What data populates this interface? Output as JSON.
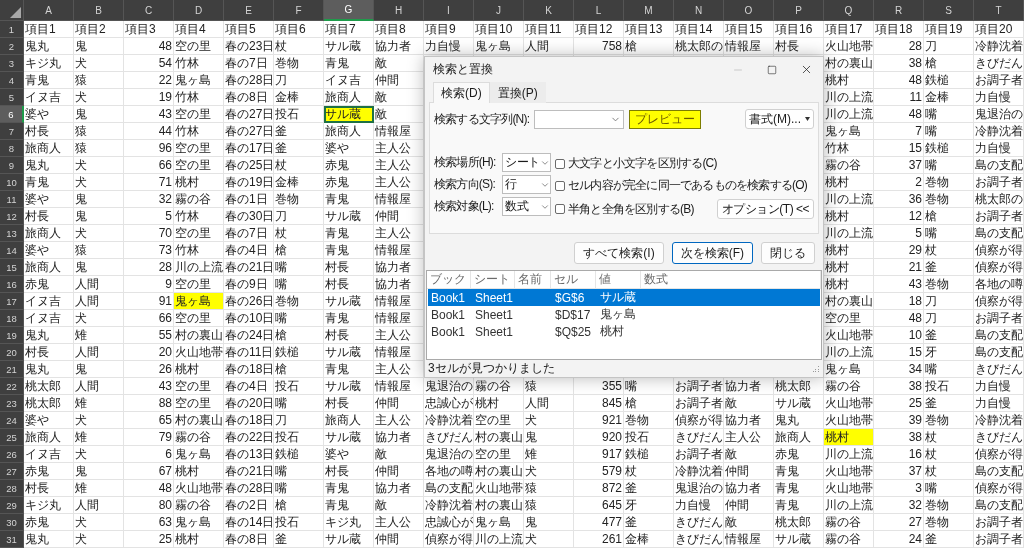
{
  "sheet": {
    "columns": [
      {
        "label": "A",
        "kind": "text",
        "selected": false
      },
      {
        "label": "B",
        "kind": "text",
        "selected": false
      },
      {
        "label": "C",
        "kind": "number",
        "selected": false
      },
      {
        "label": "D",
        "kind": "text",
        "selected": false
      },
      {
        "label": "E",
        "kind": "text",
        "selected": false
      },
      {
        "label": "F",
        "kind": "text",
        "selected": false
      },
      {
        "label": "G",
        "kind": "text",
        "selected": true
      },
      {
        "label": "H",
        "kind": "text",
        "selected": false
      },
      {
        "label": "I",
        "kind": "text",
        "selected": false
      },
      {
        "label": "J",
        "kind": "text",
        "selected": false
      },
      {
        "label": "K",
        "kind": "text",
        "selected": false
      },
      {
        "label": "L",
        "kind": "number",
        "selected": false
      },
      {
        "label": "M",
        "kind": "text",
        "selected": false
      },
      {
        "label": "N",
        "kind": "text",
        "selected": false
      },
      {
        "label": "O",
        "kind": "text",
        "selected": false
      },
      {
        "label": "P",
        "kind": "text",
        "selected": false
      },
      {
        "label": "Q",
        "kind": "text",
        "selected": false
      },
      {
        "label": "R",
        "kind": "number",
        "selected": false
      },
      {
        "label": "S",
        "kind": "text",
        "selected": false
      },
      {
        "label": "T",
        "kind": "text",
        "selected": false
      }
    ],
    "rows": [
      {
        "number": "1",
        "kind": "header",
        "selected": false,
        "cells": [
          "項目1",
          "項目2",
          "項目3",
          "項目4",
          "項目5",
          "項目6",
          "項目7",
          "項目8",
          "項目9",
          "項目10",
          "項目11",
          "項目12",
          "項目13",
          "項目14",
          "項目15",
          "項目16",
          "項目17",
          "項目18",
          "項目19",
          "項目20"
        ]
      },
      {
        "number": "2",
        "kind": "data",
        "selected": false,
        "cells": [
          "鬼丸",
          "鬼",
          "48",
          "空の里",
          "春の23日",
          "杖",
          "サル蔵",
          "協力者",
          "力自慢",
          "鬼ヶ島",
          "人間",
          "758",
          "槍",
          "桃太郎の",
          "情報屋",
          "村長",
          "火山地帯",
          "28",
          "刀",
          "冷静沈着"
        ]
      },
      {
        "number": "3",
        "kind": "data",
        "selected": false,
        "cells": [
          "キジ丸",
          "犬",
          "54",
          "竹林",
          "春の7日",
          "巻物",
          "青鬼",
          "敵",
          null,
          null,
          null,
          null,
          null,
          null,
          null,
          null,
          "村の裏山",
          "38",
          "槍",
          "きびだん"
        ]
      },
      {
        "number": "4",
        "kind": "data",
        "selected": false,
        "cells": [
          "青鬼",
          "猿",
          "22",
          "鬼ヶ島",
          "春の28日",
          "刀",
          "イヌ吉",
          "仲間",
          null,
          null,
          null,
          null,
          null,
          null,
          null,
          null,
          "桃村",
          "48",
          "鉄槌",
          "お調子者"
        ]
      },
      {
        "number": "5",
        "kind": "data",
        "selected": false,
        "cells": [
          "イヌ吉",
          "犬",
          "19",
          "竹林",
          "春の8日",
          "金棒",
          "旅商人",
          "敵",
          null,
          null,
          null,
          null,
          null,
          null,
          null,
          null,
          "川の上流",
          "11",
          "金棒",
          "力自慢"
        ]
      },
      {
        "number": "6",
        "kind": "data",
        "selected": true,
        "cells": [
          "婆や",
          "鬼",
          "43",
          "空の里",
          "春の27日",
          "投石",
          {
            "text": "サル蔵",
            "highlighted": true,
            "active": true
          },
          "敵",
          null,
          null,
          null,
          null,
          null,
          null,
          null,
          null,
          "川の上流",
          "48",
          "嘴",
          "鬼退治の"
        ]
      },
      {
        "number": "7",
        "kind": "data",
        "selected": false,
        "cells": [
          "村長",
          "猿",
          "44",
          "竹林",
          "春の27日",
          "釜",
          "旅商人",
          "情報屋",
          null,
          null,
          null,
          null,
          null,
          null,
          null,
          null,
          "鬼ヶ島",
          "7",
          "嘴",
          "冷静沈着"
        ]
      },
      {
        "number": "8",
        "kind": "data",
        "selected": false,
        "cells": [
          "旅商人",
          "猿",
          "96",
          "空の里",
          "春の17日",
          "釜",
          "婆や",
          "主人公",
          null,
          null,
          null,
          null,
          null,
          null,
          null,
          null,
          "竹林",
          "15",
          "鉄槌",
          "力自慢"
        ]
      },
      {
        "number": "9",
        "kind": "data",
        "selected": false,
        "cells": [
          "鬼丸",
          "犬",
          "66",
          "空の里",
          "春の25日",
          "杖",
          "赤鬼",
          "主人公",
          null,
          null,
          null,
          null,
          null,
          null,
          null,
          null,
          "霧の谷",
          "37",
          "嘴",
          "島の支配"
        ]
      },
      {
        "number": "10",
        "kind": "data",
        "selected": false,
        "cells": [
          "青鬼",
          "犬",
          "71",
          "桃村",
          "春の19日",
          "金棒",
          "赤鬼",
          "主人公",
          null,
          null,
          null,
          null,
          null,
          null,
          null,
          null,
          "桃村",
          "2",
          "巻物",
          "お調子者"
        ]
      },
      {
        "number": "11",
        "kind": "data",
        "selected": false,
        "cells": [
          "婆や",
          "鬼",
          "32",
          "霧の谷",
          "春の1日",
          "巻物",
          "青鬼",
          "情報屋",
          null,
          null,
          null,
          null,
          null,
          null,
          null,
          null,
          "川の上流",
          "36",
          "巻物",
          "桃太郎の"
        ]
      },
      {
        "number": "12",
        "kind": "data",
        "selected": false,
        "cells": [
          "村長",
          "鬼",
          "5",
          "竹林",
          "春の30日",
          "刀",
          "サル蔵",
          "仲間",
          null,
          null,
          null,
          null,
          null,
          null,
          null,
          null,
          "桃村",
          "12",
          "槍",
          "お調子者"
        ]
      },
      {
        "number": "13",
        "kind": "data",
        "selected": false,
        "cells": [
          "旅商人",
          "犬",
          "70",
          "空の里",
          "春の7日",
          "杖",
          "青鬼",
          "主人公",
          null,
          null,
          null,
          null,
          null,
          null,
          null,
          null,
          "川の上流",
          "5",
          "嘴",
          "島の支配"
        ]
      },
      {
        "number": "14",
        "kind": "data",
        "selected": false,
        "cells": [
          "婆や",
          "猿",
          "73",
          "竹林",
          "春の4日",
          "槍",
          "青鬼",
          "情報屋",
          null,
          null,
          null,
          null,
          null,
          null,
          null,
          null,
          "桃村",
          "29",
          "杖",
          "偵察が得"
        ]
      },
      {
        "number": "15",
        "kind": "data",
        "selected": false,
        "cells": [
          "旅商人",
          "鬼",
          "28",
          "川の上流",
          "春の21日",
          "嘴",
          "村長",
          "協力者",
          null,
          null,
          null,
          null,
          null,
          null,
          null,
          null,
          "桃村",
          "21",
          "釜",
          "偵察が得"
        ]
      },
      {
        "number": "16",
        "kind": "data",
        "selected": false,
        "cells": [
          "赤鬼",
          "人間",
          "9",
          "空の里",
          "春の9日",
          "嘴",
          "村長",
          "協力者",
          null,
          null,
          null,
          null,
          null,
          null,
          null,
          null,
          "桃村",
          "43",
          "巻物",
          "各地の噂"
        ]
      },
      {
        "number": "17",
        "kind": "data",
        "selected": false,
        "cells": [
          "イヌ吉",
          "人間",
          "91",
          {
            "text": "鬼ヶ島",
            "highlighted": true,
            "active": false
          },
          "春の26日",
          "巻物",
          "サル蔵",
          "情報屋",
          null,
          null,
          null,
          null,
          null,
          null,
          null,
          null,
          "村の裏山",
          "18",
          "刀",
          "偵察が得"
        ]
      },
      {
        "number": "18",
        "kind": "data",
        "selected": false,
        "cells": [
          "イヌ吉",
          "犬",
          "66",
          "空の里",
          "春の10日",
          "嘴",
          "青鬼",
          "情報屋",
          null,
          null,
          null,
          null,
          null,
          null,
          null,
          null,
          "空の里",
          "48",
          "刀",
          "お調子者"
        ]
      },
      {
        "number": "19",
        "kind": "data",
        "selected": false,
        "cells": [
          "鬼丸",
          "雉",
          "55",
          "村の裏山",
          "春の24日",
          "槍",
          "村長",
          "主人公",
          null,
          null,
          null,
          null,
          null,
          null,
          null,
          null,
          "火山地帯",
          "10",
          "釜",
          "島の支配"
        ]
      },
      {
        "number": "20",
        "kind": "data",
        "selected": false,
        "cells": [
          "村長",
          "人間",
          "20",
          "火山地帯",
          "春の11日",
          "鉄槌",
          "サル蔵",
          "情報屋",
          null,
          null,
          null,
          null,
          null,
          null,
          null,
          null,
          "川の上流",
          "15",
          "牙",
          "島の支配"
        ]
      },
      {
        "number": "21",
        "kind": "data",
        "selected": false,
        "cells": [
          "鬼丸",
          "鬼",
          "26",
          "桃村",
          "春の18日",
          "槍",
          "青鬼",
          "主人公",
          null,
          null,
          null,
          null,
          null,
          null,
          null,
          null,
          "鬼ヶ島",
          "34",
          "嘴",
          "きびだん"
        ]
      },
      {
        "number": "22",
        "kind": "data",
        "selected": false,
        "cells": [
          "桃太郎",
          "人間",
          "43",
          "空の里",
          "春の4日",
          "投石",
          "サル蔵",
          "情報屋",
          "鬼退治の",
          "霧の谷",
          "猿",
          "355",
          "嘴",
          "お調子者",
          "協力者",
          "桃太郎",
          "霧の谷",
          "38",
          "投石",
          "力自慢"
        ]
      },
      {
        "number": "23",
        "kind": "data",
        "selected": false,
        "cells": [
          "桃太郎",
          "雉",
          "88",
          "空の里",
          "春の20日",
          "嘴",
          "村長",
          "仲間",
          "忠誠心が",
          "桃村",
          "人間",
          "845",
          "槍",
          "お調子者",
          "敵",
          "サル蔵",
          "火山地帯",
          "25",
          "釜",
          "力自慢"
        ]
      },
      {
        "number": "24",
        "kind": "data",
        "selected": false,
        "cells": [
          "婆や",
          "犬",
          "65",
          "村の裏山",
          "春の18日",
          "刀",
          "旅商人",
          "主人公",
          "冷静沈着",
          "空の里",
          "犬",
          "921",
          "巻物",
          "偵察が得",
          "協力者",
          "鬼丸",
          "火山地帯",
          "39",
          "巻物",
          "冷静沈着"
        ]
      },
      {
        "number": "25",
        "kind": "data",
        "selected": false,
        "cells": [
          "旅商人",
          "雉",
          "79",
          "霧の谷",
          "春の22日",
          "投石",
          "サル蔵",
          "協力者",
          "きびだん",
          "村の裏山",
          "鬼",
          "920",
          "投石",
          "きびだん",
          "主人公",
          "旅商人",
          {
            "text": "桃村",
            "highlighted": true,
            "active": false
          },
          "38",
          "杖",
          "きびだん"
        ]
      },
      {
        "number": "26",
        "kind": "data",
        "selected": false,
        "cells": [
          "イヌ吉",
          "犬",
          "6",
          "鬼ヶ島",
          "春の13日",
          "鉄槌",
          "婆や",
          "敵",
          "鬼退治の",
          "空の里",
          "雉",
          "917",
          "鉄槌",
          "お調子者",
          "敵",
          "赤鬼",
          "川の上流",
          "16",
          "杖",
          "偵察が得"
        ]
      },
      {
        "number": "27",
        "kind": "data",
        "selected": false,
        "cells": [
          "赤鬼",
          "鬼",
          "67",
          "桃村",
          "春の21日",
          "嘴",
          "村長",
          "仲間",
          "各地の噂",
          "村の裏山",
          "犬",
          "579",
          "杖",
          "冷静沈着",
          "仲間",
          "青鬼",
          "火山地帯",
          "37",
          "杖",
          "島の支配"
        ]
      },
      {
        "number": "28",
        "kind": "data",
        "selected": false,
        "cells": [
          "村長",
          "雉",
          "48",
          "火山地帯",
          "春の28日",
          "嘴",
          "青鬼",
          "協力者",
          "島の支配",
          "火山地帯",
          "猿",
          "872",
          "釜",
          "鬼退治の",
          "協力者",
          "青鬼",
          "火山地帯",
          "3",
          "嘴",
          "偵察が得"
        ]
      },
      {
        "number": "29",
        "kind": "data",
        "selected": false,
        "cells": [
          "キジ丸",
          "人間",
          "80",
          "霧の谷",
          "春の2日",
          "槍",
          "青鬼",
          "敵",
          "冷静沈着",
          "村の裏山",
          "猿",
          "645",
          "牙",
          "力自慢",
          "仲間",
          "青鬼",
          "川の上流",
          "32",
          "巻物",
          "島の支配"
        ]
      },
      {
        "number": "30",
        "kind": "data",
        "selected": false,
        "cells": [
          "赤鬼",
          "犬",
          "63",
          "鬼ヶ島",
          "春の14日",
          "投石",
          "キジ丸",
          "主人公",
          "忠誠心が",
          "鬼ヶ島",
          "鬼",
          "477",
          "釜",
          "きびだん",
          "敵",
          "桃太郎",
          "霧の谷",
          "27",
          "巻物",
          "お調子者"
        ]
      },
      {
        "number": "31",
        "kind": "data",
        "selected": false,
        "cells": [
          "鬼丸",
          "犬",
          "25",
          "桃村",
          "春の8日",
          "釜",
          "サル蔵",
          "仲間",
          "偵察が得",
          "川の上流",
          "犬",
          "261",
          "金棒",
          "きびだん",
          "情報屋",
          "サル蔵",
          "霧の谷",
          "24",
          "釜",
          "お調子者"
        ]
      }
    ]
  },
  "dialog": {
    "title": "検索と置換",
    "tabs": [
      {
        "label": "検索(D)",
        "selected": true
      },
      {
        "label": "置換(P)",
        "selected": false
      }
    ],
    "find_label": "検索する文字列(N):",
    "preview": "プレビュー",
    "format_button": "書式(M)...",
    "selects": [
      {
        "label": "検索場所(H):",
        "value": "シート"
      },
      {
        "label": "検索方向(S):",
        "value": "行"
      },
      {
        "label": "検索対象(L):",
        "value": "数式"
      }
    ],
    "checkboxes": [
      {
        "label": "大文字と小文字を区別する(C)",
        "checked": false
      },
      {
        "label": "セル内容が完全に同一であるものを検索する(O)",
        "checked": false
      },
      {
        "label": "半角と全角を区別する(B)",
        "checked": false
      }
    ],
    "options_button": "オプション(T) <<",
    "buttons": [
      {
        "label": "すべて検索(I)",
        "default": false
      },
      {
        "label": "次を検索(F)",
        "default": true
      },
      {
        "label": "閉じる",
        "default": false
      }
    ],
    "results": {
      "columns": [
        "ブック",
        "シート",
        "名前",
        "セル",
        "値",
        "数式"
      ],
      "rows": [
        {
          "book": "Book1",
          "sheet": "Sheet1",
          "cell": "$G$6",
          "value": "サル蔵",
          "selected": true
        },
        {
          "book": "Book1",
          "sheet": "Sheet1",
          "cell": "$D$17",
          "value": "鬼ヶ島",
          "selected": false
        },
        {
          "book": "Book1",
          "sheet": "Sheet1",
          "cell": "$Q$25",
          "value": "桃村",
          "selected": false
        }
      ]
    },
    "status": "3セルが見つかりました"
  }
}
